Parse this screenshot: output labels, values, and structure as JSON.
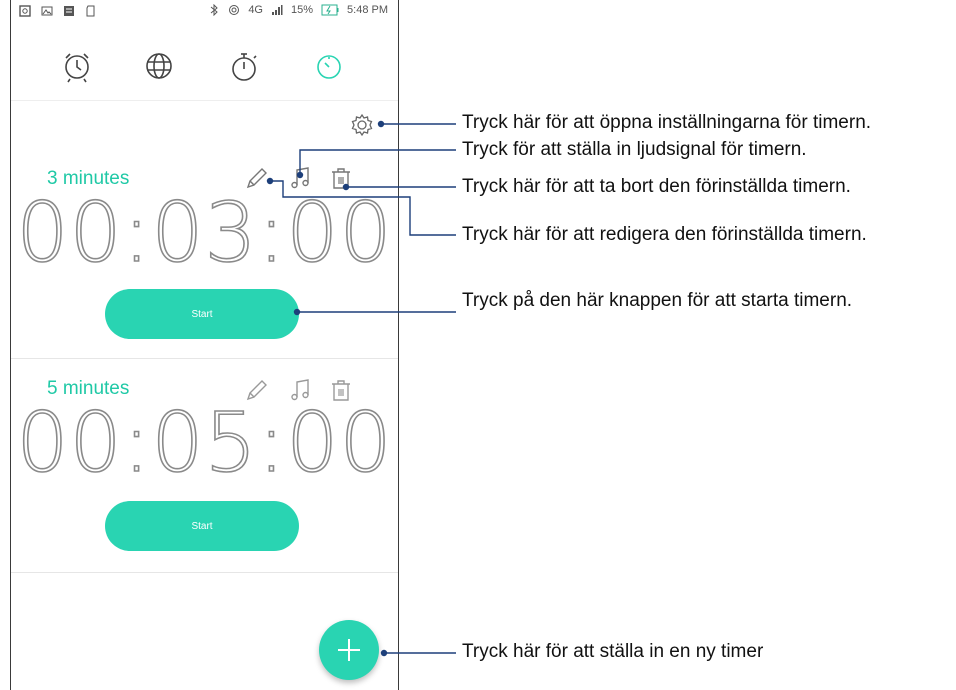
{
  "status_bar": {
    "battery": "15%",
    "time": "5:48 PM",
    "network": "4G"
  },
  "tabs": [
    {
      "icon": "alarm-clock-icon"
    },
    {
      "icon": "world-clock-icon"
    },
    {
      "icon": "stopwatch-icon"
    },
    {
      "icon": "timer-icon",
      "active": true
    }
  ],
  "accent_color": "#29d4b2",
  "timers": [
    {
      "name": "3 minutes",
      "time": "00:03:00",
      "start_label": "Start"
    },
    {
      "name": "5 minutes",
      "time": "00:05:00",
      "start_label": "Start"
    }
  ],
  "callouts": {
    "settings": "Tryck här för att öppna inställningarna för timern.",
    "sound": "Tryck för att ställa in ljudsignal för timern.",
    "delete": "Tryck här för att ta bort den förinställda timern.",
    "edit": "Tryck här för att redigera den förinställda timern.",
    "start": "Tryck på den här knappen för att starta timern.",
    "add": "Tryck här för att ställa in en ny timer"
  }
}
